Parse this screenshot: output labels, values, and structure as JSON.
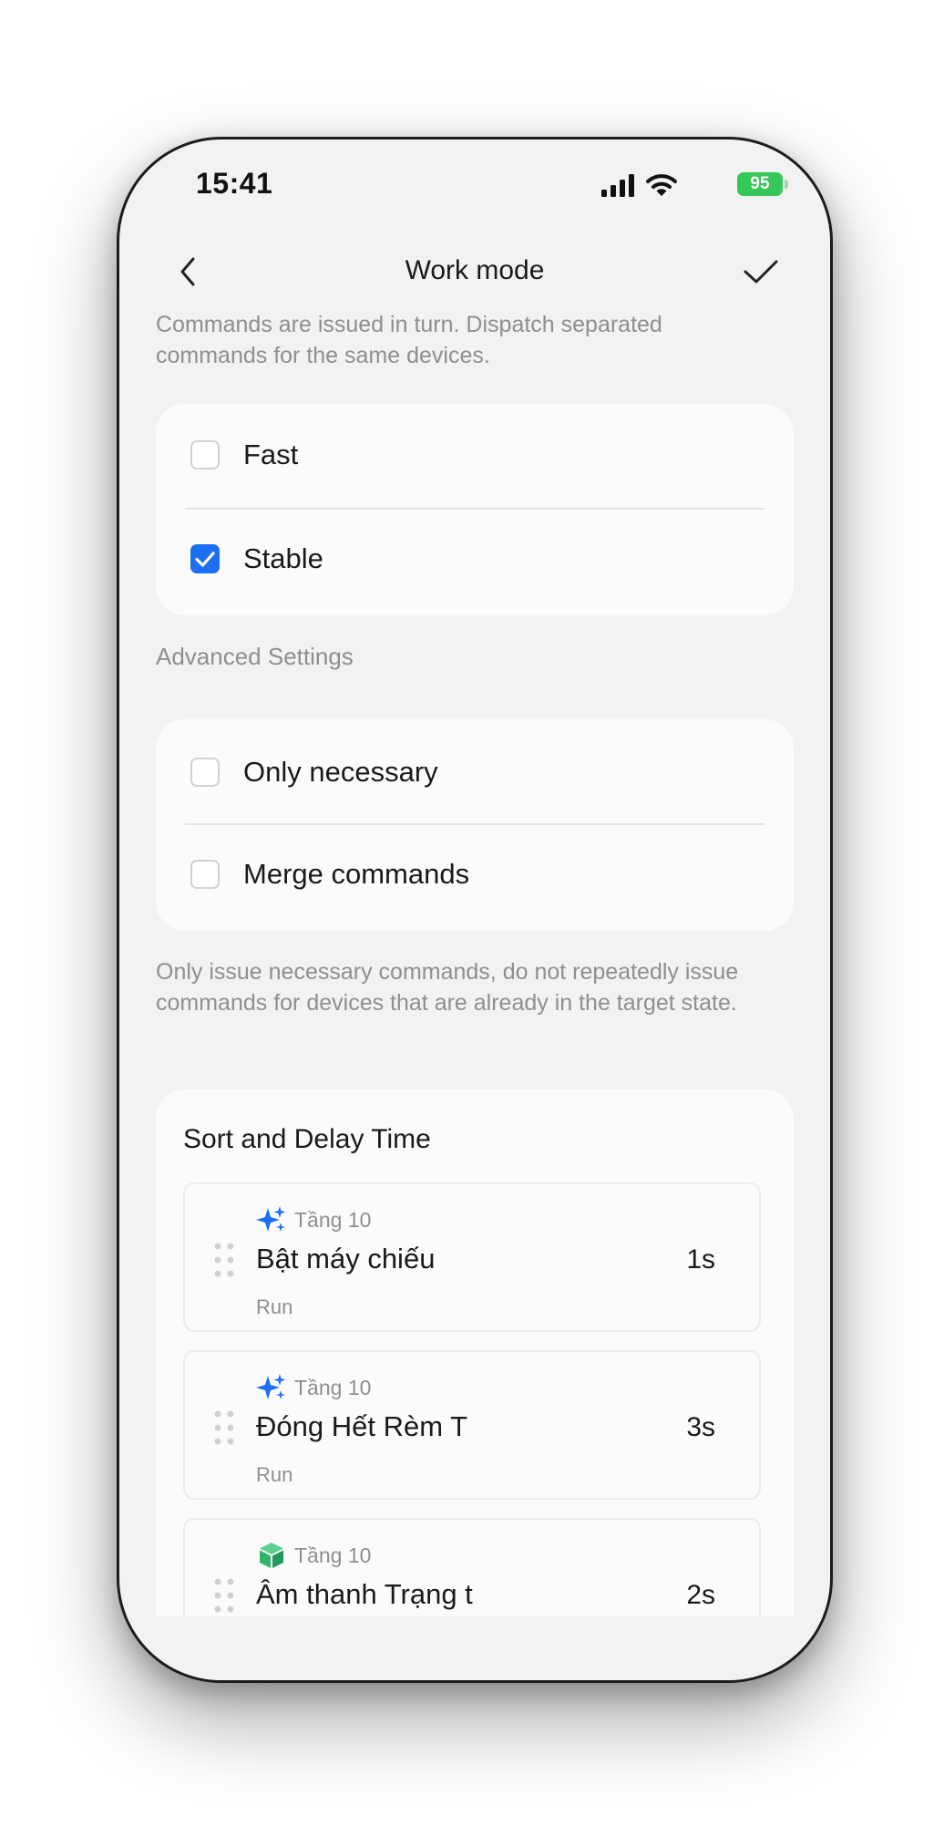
{
  "status_bar": {
    "time": "15:41",
    "battery": "95",
    "icons": [
      "signal-icon",
      "wifi-icon",
      "battery-icon"
    ]
  },
  "nav": {
    "title": "Work mode",
    "back_icon": "chevron-left-icon",
    "confirm_icon": "checkmark-icon"
  },
  "mode": {
    "description": "Commands are issued in turn. Dispatch separated commands for the same devices.",
    "options": [
      {
        "label": "Fast",
        "checked": false
      },
      {
        "label": "Stable",
        "checked": true
      }
    ]
  },
  "advanced": {
    "title": "Advanced Settings",
    "options": [
      {
        "label": "Only necessary",
        "checked": false
      },
      {
        "label": "Merge commands",
        "checked": false
      }
    ],
    "description": "Only issue necessary commands, do not repeatedly issue commands for devices that are already in the target state."
  },
  "sort": {
    "title": "Sort and Delay Time",
    "tasks": [
      {
        "icon": "sparkle-scene-icon",
        "room": "Tầng 10",
        "name": "Bật máy chiếu",
        "delay": "1s",
        "action": "Run"
      },
      {
        "icon": "sparkle-scene-icon",
        "room": "Tầng 10",
        "name": "Đóng Hết Rèm T",
        "delay": "3s",
        "action": "Run"
      },
      {
        "icon": "cube-device-icon",
        "room": "Tầng 10",
        "name": "Âm thanh Trạng t",
        "delay": "2s",
        "action": ""
      }
    ]
  },
  "colors": {
    "accent": "#1c6ef2",
    "battery": "#35c759",
    "device_icon": "#2fb56a",
    "background": "#f2f2f2",
    "card": "#fbfbfb"
  }
}
